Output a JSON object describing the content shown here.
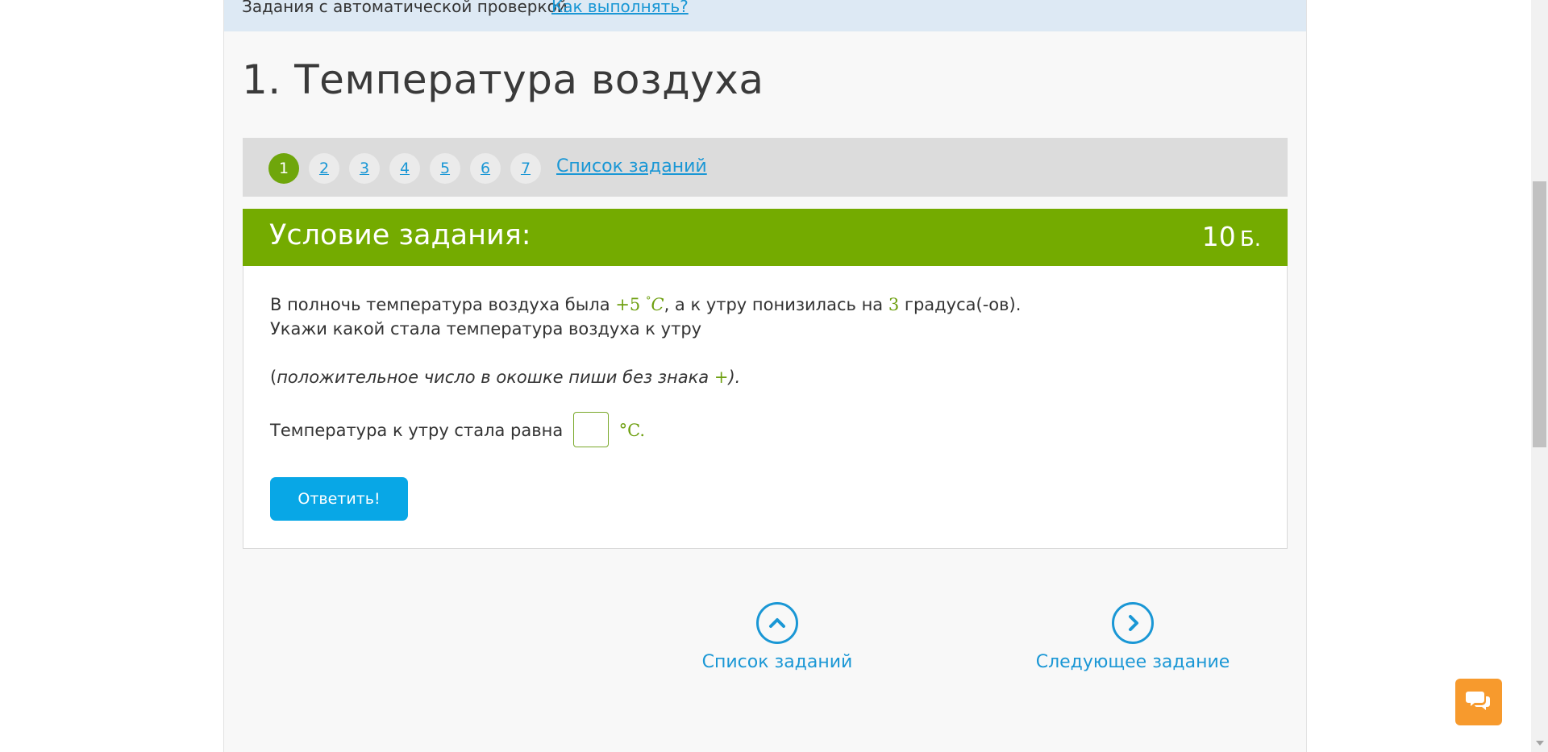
{
  "header": {
    "title": "Задания с автоматической проверкой",
    "howto_link": "Как выполнять?"
  },
  "page_title": "1. Температура воздуха",
  "task_nav": {
    "numbers": [
      "1",
      "2",
      "3",
      "4",
      "5",
      "6",
      "7"
    ],
    "active": "1",
    "list_link": "Список заданий"
  },
  "condition": {
    "title": "Условие задания:",
    "points_value": "10",
    "points_unit": "Б."
  },
  "problem": {
    "line1_part1": "В полночь температура воздуха была",
    "temp_value": "+5",
    "degree_symbol": "°",
    "unit_letter": "C",
    "line1_part2": ", а к утру понизилась на",
    "drop_value": "3",
    "line1_part3": "градуса(-ов).",
    "line2": "Укажи какой стала температура воздуха к утру",
    "hint_open": "(",
    "hint_text": "положительное число в окошке пиши без знака",
    "hint_plus": "+",
    "hint_close": ").",
    "answer_prefix": "Температура к утру стала равна",
    "answer_unit": "°C",
    "answer_suffix": ".",
    "answer_value": ""
  },
  "submit_label": "Ответить!",
  "bottom_nav": {
    "list_label": "Список заданий",
    "next_label": "Следующее задание"
  },
  "colors": {
    "accent_green": "#74ab00",
    "link_blue": "#1a97d5",
    "button_blue": "#08a7e6",
    "chat_orange": "#f79a2d"
  }
}
